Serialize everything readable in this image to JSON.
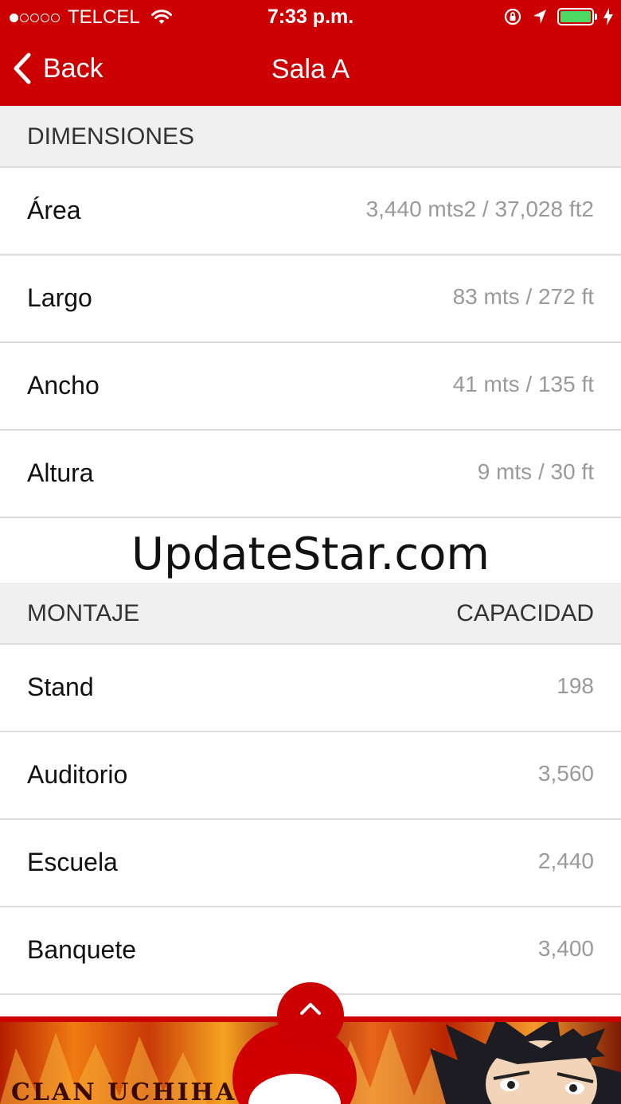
{
  "status_bar": {
    "carrier": "TELCEL",
    "time": "7:33 p.m."
  },
  "nav": {
    "back_label": "Back",
    "title": "Sala A"
  },
  "dimensiones": {
    "header": "DIMENSIONES",
    "rows": [
      {
        "label": "Área",
        "value": "3,440 mts2 / 37,028 ft2"
      },
      {
        "label": "Largo",
        "value": "83 mts / 272 ft"
      },
      {
        "label": "Ancho",
        "value": "41 mts / 135 ft"
      },
      {
        "label": "Altura",
        "value": "9 mts / 30 ft"
      }
    ]
  },
  "watermark": "UpdateStar.com",
  "montaje": {
    "header_left": "MONTAJE",
    "header_right": "CAPACIDAD",
    "rows": [
      {
        "label": "Stand",
        "value": "198"
      },
      {
        "label": "Auditorio",
        "value": "3,560"
      },
      {
        "label": "Escuela",
        "value": "2,440"
      },
      {
        "label": "Banquete",
        "value": "3,400"
      }
    ]
  },
  "banner": {
    "caption": "CLAN UCHIHA",
    "scroll_top_icon": "chevron-up-icon"
  },
  "colors": {
    "accent": "#cc0000",
    "section_bg": "#f0f0f0",
    "value_text": "#9a9a9a",
    "battery": "#4cd964"
  }
}
